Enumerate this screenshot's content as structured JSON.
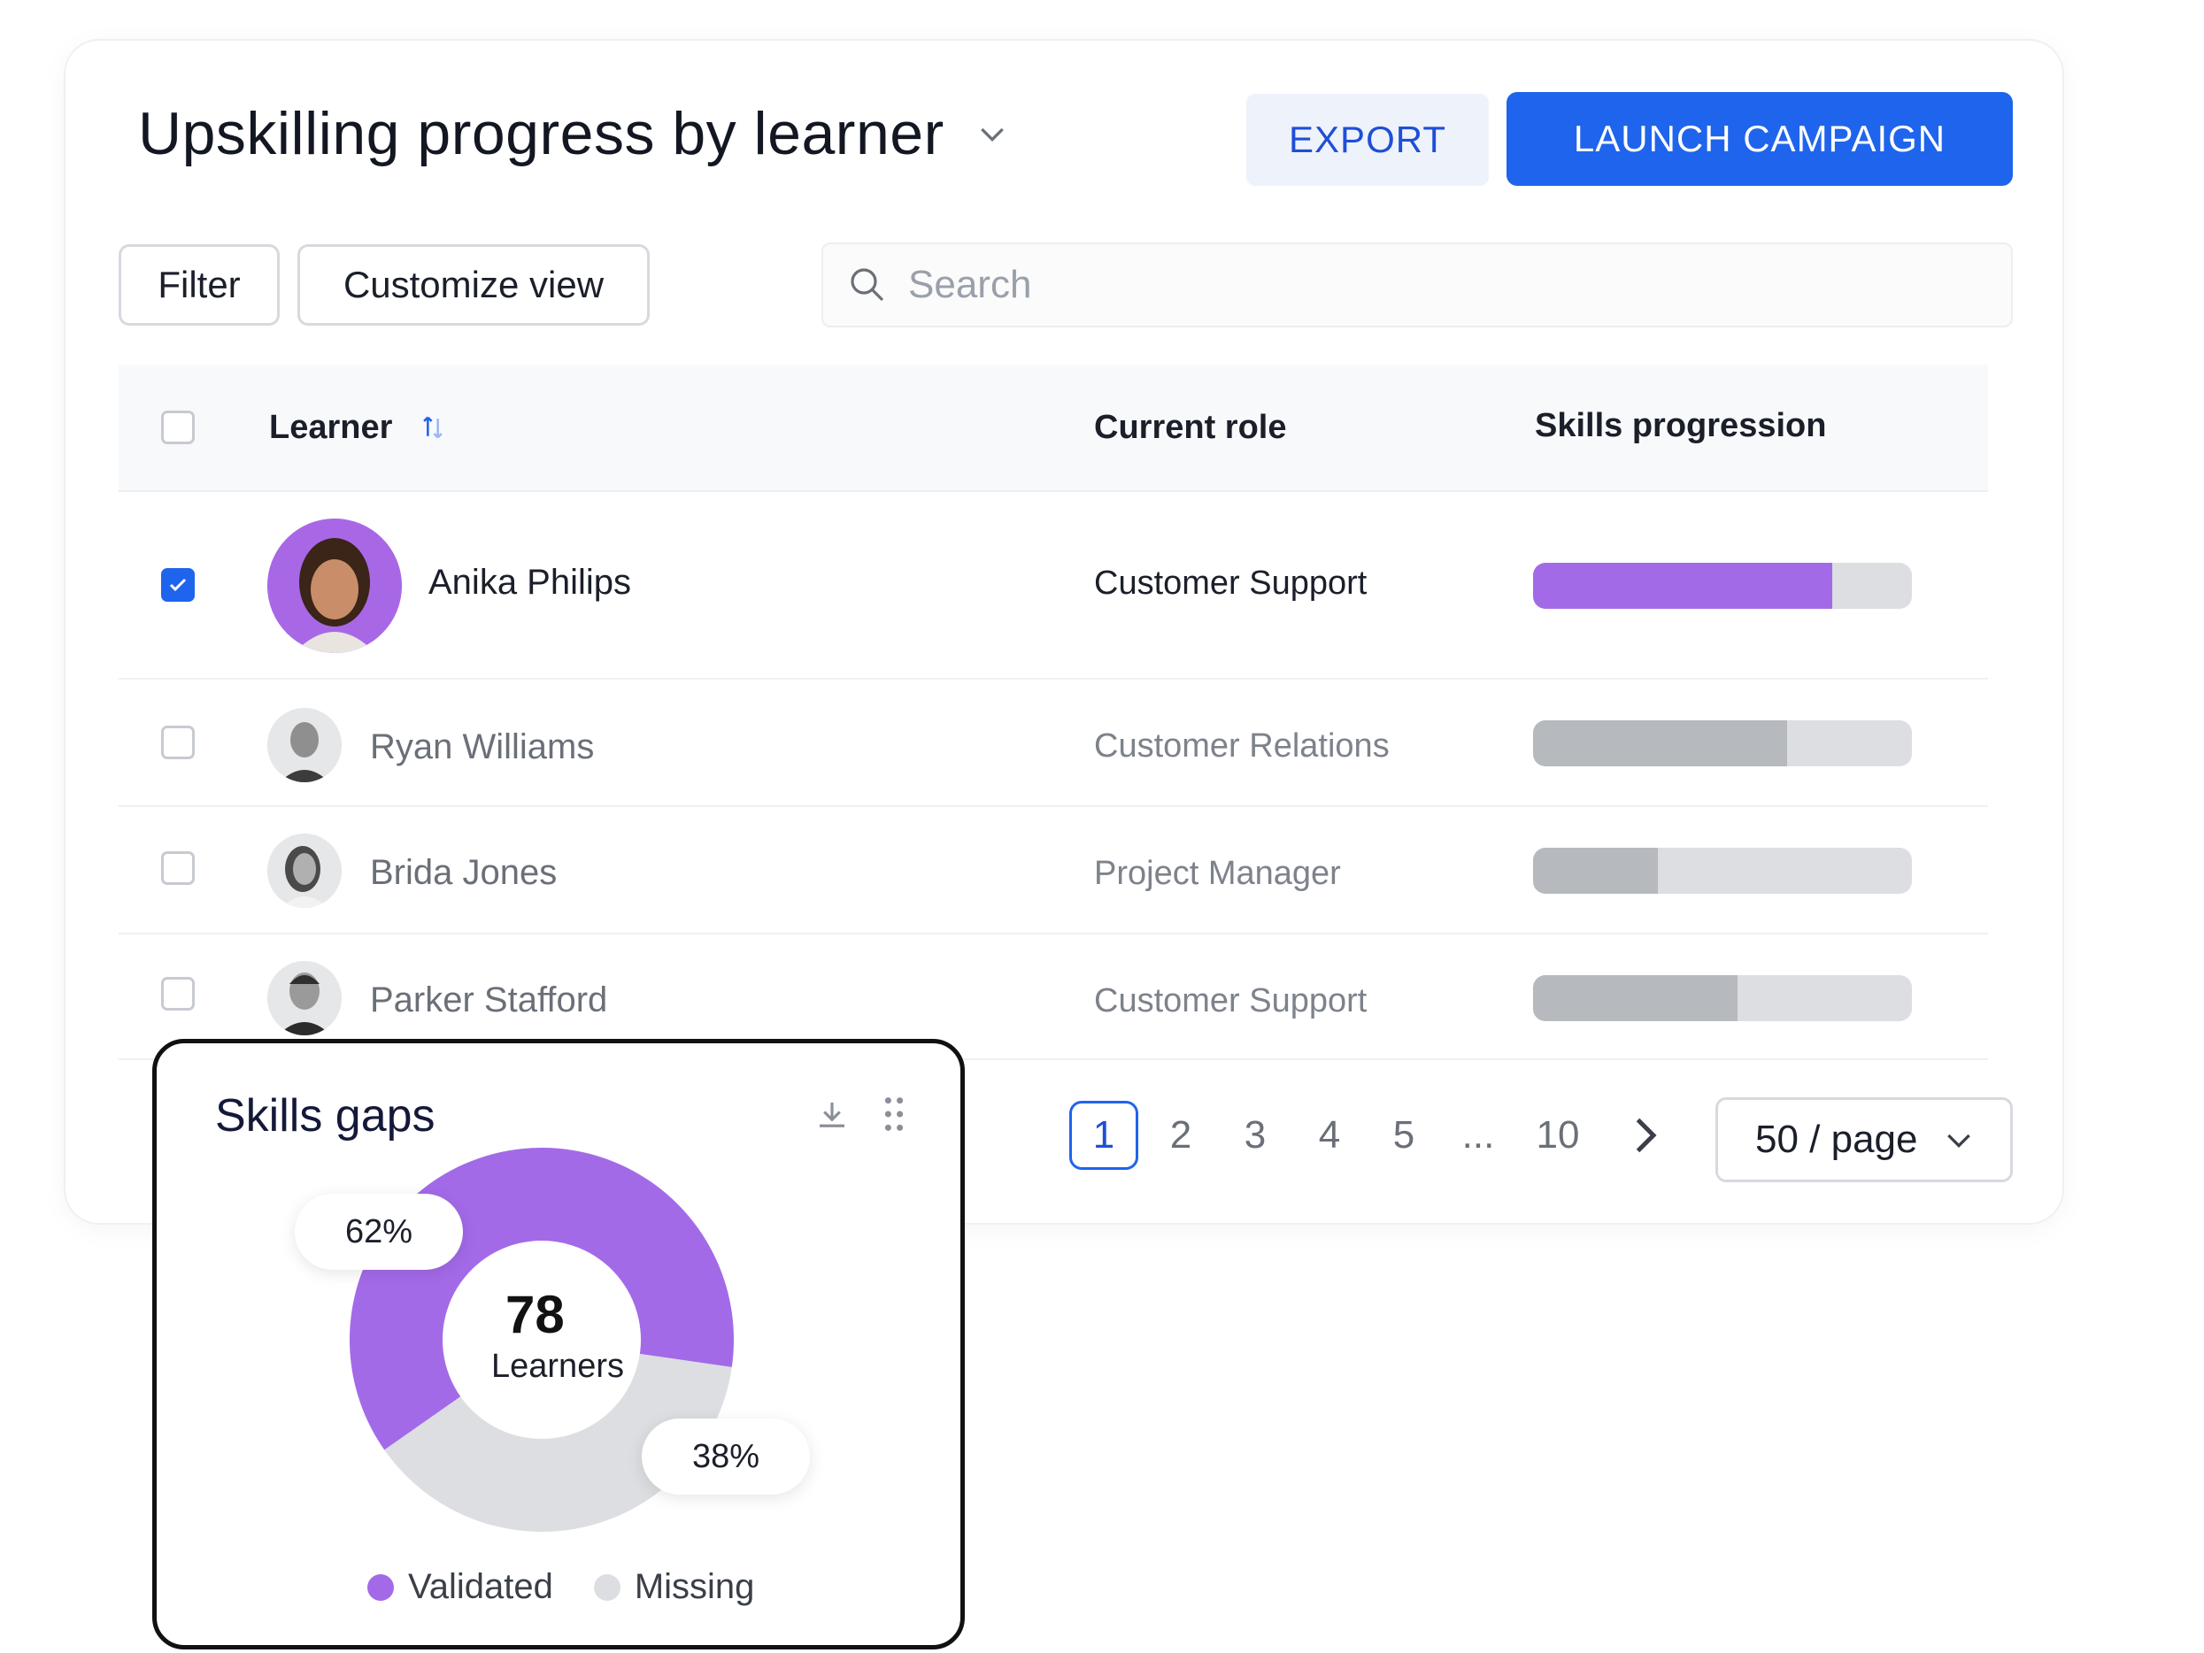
{
  "header": {
    "title": "Upskilling progress by learner",
    "export_label": "EXPORT",
    "launch_label": "LAUNCH CAMPAIGN"
  },
  "toolbar": {
    "filter_label": "Filter",
    "customize_label": "Customize view",
    "search_placeholder": "Search"
  },
  "table": {
    "columns": {
      "learner": "Learner",
      "role": "Current role",
      "skills": "Skills progression"
    },
    "rows": [
      {
        "name": "Anika Philips",
        "role": "Customer Support",
        "progress": 0.79,
        "selected": true
      },
      {
        "name": "Ryan Williams",
        "role": "Customer Relations",
        "progress": 0.67,
        "selected": false
      },
      {
        "name": "Brida Jones",
        "role": "Project Manager",
        "progress": 0.33,
        "selected": false
      },
      {
        "name": "Parker Stafford",
        "role": "Customer Support",
        "progress": 0.54,
        "selected": false
      }
    ]
  },
  "pagination": {
    "current": "1",
    "pages": [
      "2",
      "3",
      "4",
      "5",
      "...",
      "10"
    ],
    "per_page": "50 / page"
  },
  "widget": {
    "title": "Skills gaps",
    "center_value": "78",
    "center_label": "Learners",
    "validated_pct": "62%",
    "missing_pct": "38%",
    "legend_validated": "Validated",
    "legend_missing": "Missing",
    "colors": {
      "validated": "#a36ae8",
      "missing": "#dcdee2"
    }
  },
  "chart_data": {
    "type": "pie",
    "title": "Skills gaps",
    "categories": [
      "Validated",
      "Missing"
    ],
    "values": [
      62,
      38
    ],
    "units": "%",
    "center_text": "78 Learners"
  },
  "colors": {
    "accent": "#1f64ec",
    "progress_active": "#a36ae8",
    "progress_inactive": "#b6b9be"
  }
}
